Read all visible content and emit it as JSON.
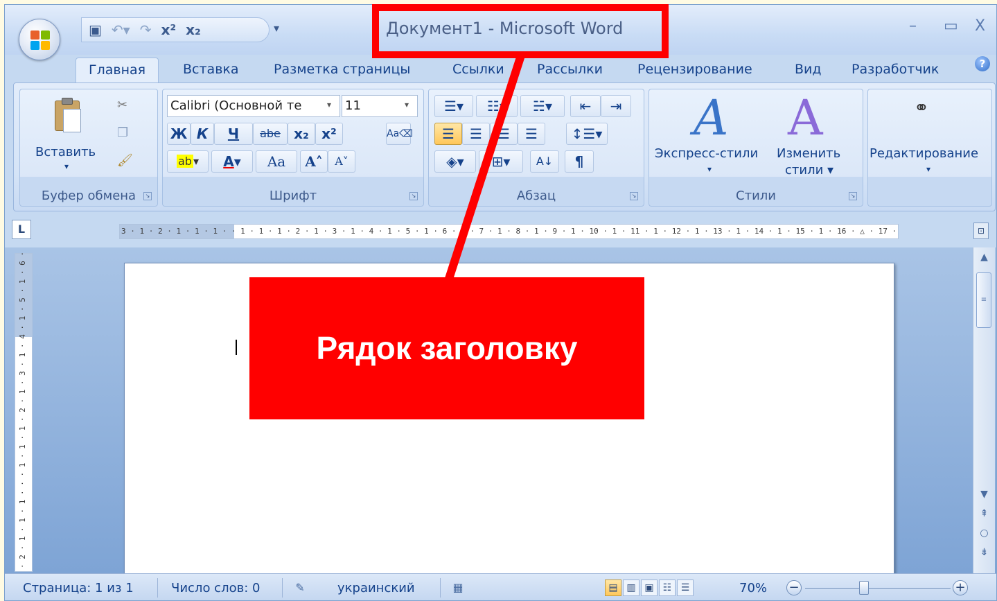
{
  "window": {
    "title": "Документ1 - Microsoft Word",
    "controls": {
      "minimize": "–",
      "maximize": "▭",
      "close": "X"
    }
  },
  "quick_access": {
    "save_icon": "save-icon",
    "undo_icon": "undo-icon",
    "redo_icon": "redo-icon",
    "superscript": "x²",
    "subscript": "x₂",
    "more": "▾"
  },
  "tabs": [
    "Главная",
    "Вставка",
    "Разметка страницы",
    "Ссылки",
    "Рассылки",
    "Рецензирование",
    "Вид",
    "Разработчик"
  ],
  "help": "?",
  "ribbon": {
    "clipboard": {
      "label": "Буфер обмена",
      "paste": "Вставить",
      "paste_arrow": "▾"
    },
    "font": {
      "label": "Шрифт",
      "font_name": "Calibri (Основной те",
      "font_size": "11",
      "bold": "Ж",
      "italic": "К",
      "underline": "Ч",
      "strike": "abe",
      "sub": "x₂",
      "sup": "x²",
      "case": "Aa",
      "grow": "A˄",
      "shrink": "A˅",
      "color_letter": "A"
    },
    "paragraph": {
      "label": "Абзац",
      "pilcrow": "¶",
      "sort": "А↓"
    },
    "styles": {
      "label": "Стили",
      "quick_styles": "Экспресс-стили",
      "change_styles": "Изменить",
      "change_styles2": "стили ▾"
    },
    "editing": {
      "label": "Редактирование",
      "arrow": "▾"
    }
  },
  "ruler": {
    "corner": "L",
    "horizontal": "3 · 1 · 2 · 1 · 1 · 1 ·  · 1 · 1 · 1 · 2 · 1 · 3 · 1 · 4 · 1 · 5 · 1 · 6 · 1 · 7 · 1 · 8 · 1 · 9 · 1 · 10 · 1 · 11 · 1 · 12 · 1 · 13 · 1 · 14 · 1 · 15 · 1 · 16 · △ · 17 · 1 ·",
    "vertical": "· 2 · 1 · 1 · 1 · · · 1 · 1 · 1 · 2 · 1 · 3 · 1 · 4 · 1 · 5 · 1 · 6 ·"
  },
  "status": {
    "page": "Страница: 1 из 1",
    "words": "Число слов: 0",
    "language": "украинский",
    "zoom": "70%"
  },
  "annotation": {
    "callout": "Рядок заголовку",
    "color": "#ff0000"
  }
}
